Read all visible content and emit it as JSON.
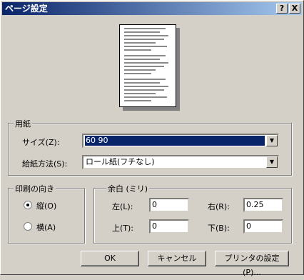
{
  "window": {
    "title": "ページ設定",
    "help_label": "?",
    "close_label": "X"
  },
  "paper": {
    "group_label": "用紙",
    "size_label": "サイズ(Z):",
    "size_value": "60 90",
    "source_label": "給紙方法(S):",
    "source_value": "ロール紙(フチなし)"
  },
  "orientation": {
    "group_label": "印刷の向き",
    "portrait_label": "縦(O)",
    "landscape_label": "横(A)",
    "selected": "portrait"
  },
  "margins": {
    "group_label": "余白 (ミリ)",
    "left_label": "左(L):",
    "left_value": "0",
    "right_label": "右(R):",
    "right_value": "0.25",
    "top_label": "上(T):",
    "top_value": "0",
    "bottom_label": "下(B):",
    "bottom_value": "0"
  },
  "buttons": {
    "ok": "OK",
    "cancel": "キャンセル",
    "printer": "プリンタの設定(P)..."
  },
  "icons": {
    "dropdown": "chevron-down-icon",
    "help": "help-icon",
    "close": "close-icon"
  }
}
